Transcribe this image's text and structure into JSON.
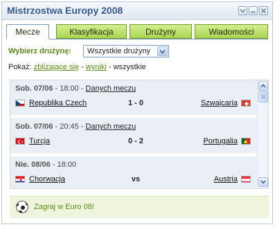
{
  "window": {
    "title": "Mistrzostwa Europy 2008"
  },
  "tabs": [
    {
      "label": "Mecze",
      "active": true
    },
    {
      "label": "Klasyfikacja",
      "active": false
    },
    {
      "label": "Drużyny",
      "active": false
    },
    {
      "label": "Wiadomości",
      "active": false
    }
  ],
  "filter": {
    "label": "Wybierz drużynę:",
    "selected": "Wszystkie drużyny"
  },
  "show": {
    "prefix": "Pokaż:",
    "upcoming": "zbliżające się",
    "sep1": " - ",
    "results": "wyniki",
    "sep2": " - ",
    "all": "wszystkie"
  },
  "matches": [
    {
      "date": "Sob. 07/06",
      "time": "- 18:00 -",
      "details": "Danych meczu",
      "home": "Republika Czech",
      "score": "1 - 0",
      "away": "Szwajcaria"
    },
    {
      "date": "Sob. 07/06",
      "time": "- 20:45 -",
      "details": "Danych meczu",
      "home": "Turcja",
      "score": "0 - 2",
      "away": "Portugalia"
    },
    {
      "date": "Nie. 08/06",
      "time": "- 18:00",
      "details": "",
      "home": "Chorwacja",
      "score": "vs",
      "away": "Austria"
    }
  ],
  "footer": {
    "text": "Zagraj w Euro 08!"
  }
}
